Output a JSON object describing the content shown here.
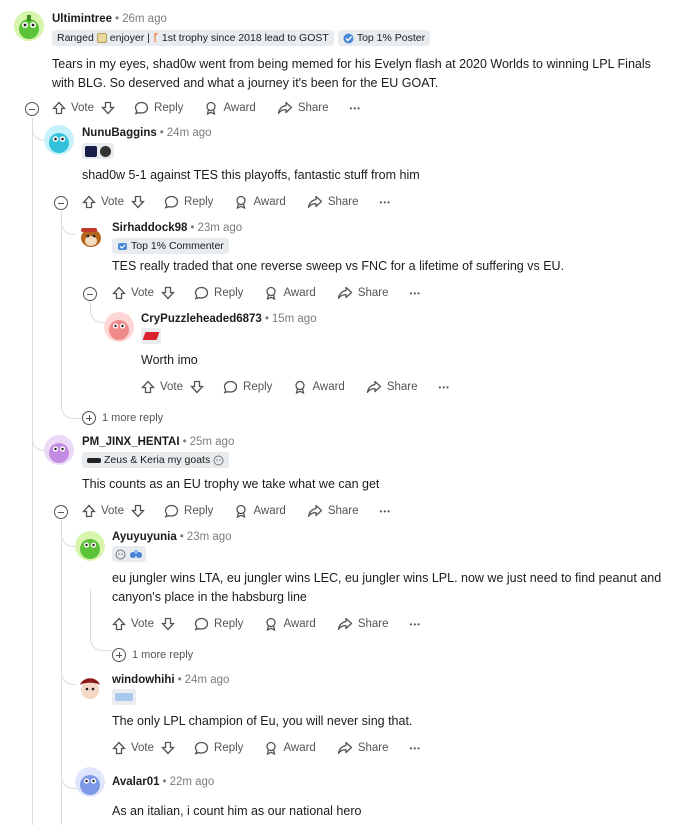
{
  "actions": {
    "vote": "Vote",
    "reply": "Reply",
    "award": "Award",
    "share": "Share",
    "overflow": "•••"
  },
  "comments": [
    {
      "username": "Ultimintree",
      "time": "26m ago",
      "flair1": "Ranged",
      "flair1b": "enjoyer |",
      "flair1c": "1st trophy since 2018 lead to GOST",
      "flair2": "Top 1% Poster",
      "body1": "Tears in my eyes, shad0w went from being memed for his Evelyn flash at 2020 Worlds to winning LPL Finals",
      "body2": "with BLG. So deserved and what a journey it's been for the EU GOAT."
    },
    {
      "username": "NunuBaggins",
      "time": "24m ago",
      "body1": "shad0w 5-1 against TES this playoffs, fantastic stuff from him"
    },
    {
      "username": "Sirhaddock98",
      "time": "23m ago",
      "flair1": "Top 1% Commenter",
      "body1": "TES really traded that one reverse sweep vs FNC for a lifetime of suffering vs EU."
    },
    {
      "username": "CryPuzzleheaded6873",
      "time": "15m ago",
      "body1": "Worth imo"
    },
    {
      "username": "PM_JINX_HENTAI",
      "time": "25m ago",
      "flair1": "Zeus & Keria my goats",
      "body1": "This counts as an EU trophy we take what we can get"
    },
    {
      "username": "Ayuyuyunia",
      "time": "23m ago",
      "body1": "eu jungler wins LTA, eu jungler wins LEC, eu jungler wins LPL. now we just need to find peanut and",
      "body2": "canyon's place in the habsburg line"
    },
    {
      "username": "windowhihi",
      "time": "24m ago",
      "body1": "The only LPL champion of Eu, you will never sing that."
    },
    {
      "username": "Avalar01",
      "time": "22m ago",
      "body1": "As an italian, i count him as our national hero"
    }
  ],
  "more_replies": [
    "1 more reply",
    "1 more reply"
  ],
  "colors": {
    "thread_line": "#d9dde0",
    "meta_gray": "#7c7c7c",
    "action_gray": "#545454",
    "flair_bg": "#e9ecee"
  }
}
